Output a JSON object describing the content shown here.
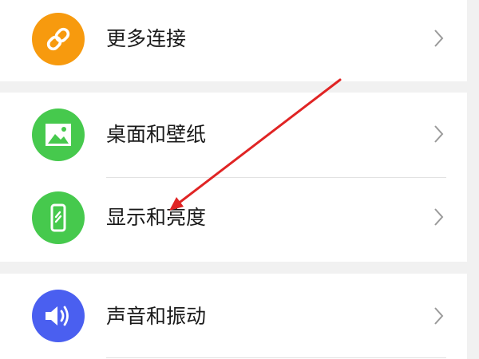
{
  "settings": {
    "items": [
      {
        "label": "更多连接",
        "icon": "link-icon",
        "color": "#f79a0e"
      },
      {
        "label": "桌面和壁纸",
        "icon": "image-icon",
        "color": "#46c94d"
      },
      {
        "label": "显示和亮度",
        "icon": "phone-brightness-icon",
        "color": "#46c94d"
      },
      {
        "label": "声音和振动",
        "icon": "speaker-icon",
        "color": "#4a5ff0"
      }
    ]
  },
  "annotation": {
    "arrow_color": "#e02424",
    "arrow_target": "显示和亮度"
  }
}
